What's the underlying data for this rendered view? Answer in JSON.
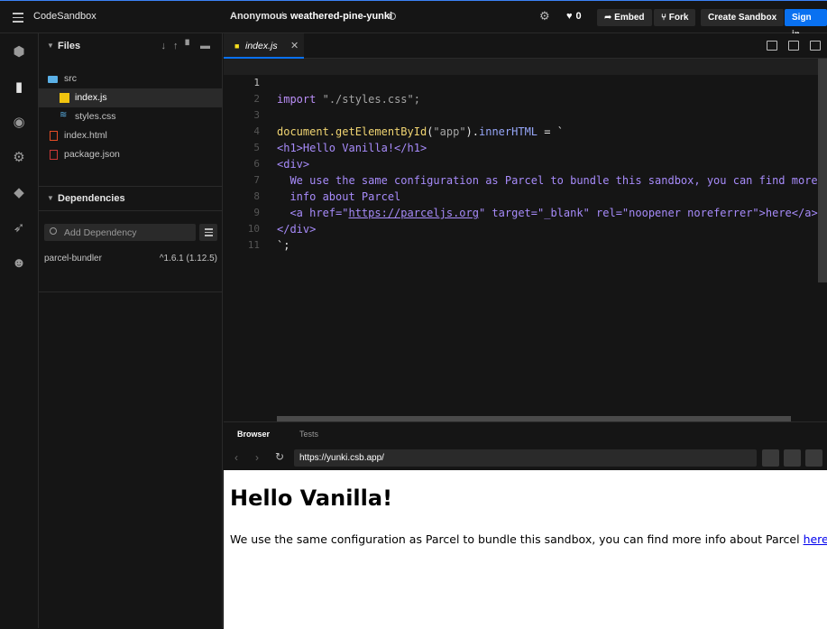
{
  "topbar": {
    "brand": "CodeSandbox",
    "owner": "Anonymous",
    "separator": "/",
    "sandbox_name": "weathered-pine-yunki",
    "likes": "0",
    "embed_label": "Embed",
    "fork_label": "Fork",
    "create_label": "Create Sandbox",
    "signin_label": "Sign in",
    "accent": "#0971f1"
  },
  "sidebar": {
    "files_title": "Files",
    "files": [
      {
        "name": "src",
        "icon": "folder-icon"
      },
      {
        "name": "index.js",
        "icon": "js-file-icon"
      },
      {
        "name": "styles.css",
        "icon": "css-file-icon"
      },
      {
        "name": "index.html",
        "icon": "html-file-icon"
      },
      {
        "name": "package.json",
        "icon": "npm-file-icon"
      }
    ],
    "dependencies_title": "Dependencies",
    "add_dependency_placeholder": "Add Dependency",
    "dependencies": [
      {
        "name": "parcel-bundler",
        "version": "^1.6.1 (1.12.5)"
      }
    ]
  },
  "editor": {
    "tab_name": "index.js",
    "line_numbers": [
      "1",
      "2",
      "3",
      "4",
      "5",
      "6",
      "7",
      "8",
      "9",
      "10",
      "11"
    ],
    "code": {
      "l1_kw": "import",
      "l1_str": "\"./styles.css\";",
      "l3_a": "document.",
      "l3_fn": "getElementById",
      "l3_b": "(",
      "l3_str": "\"app\"",
      "l3_c": ").",
      "l3_prop": "innerHTML",
      "l3_d": " = `",
      "l4": "<h1>Hello Vanilla!</h1>",
      "l5": "<div>",
      "l6": "  We use the same configuration as Parcel to bundle this sandbox, you can find more",
      "l7": "  info about Parcel",
      "l8_a": "  <a href=\"",
      "l8_link": "https://parceljs.org",
      "l8_b": "\" target=\"_blank\" rel=\"noopener noreferrer\">here</a>.",
      "l9": "</div>",
      "l10": "`;"
    }
  },
  "preview": {
    "tab_browser": "Browser",
    "tab_tests": "Tests",
    "url": "https://yunki.csb.app/",
    "page_heading": "Hello Vanilla!",
    "page_text": "We use the same configuration as Parcel to bundle this sandbox, you can find more info about Parcel ",
    "page_link": "here",
    "page_after": "."
  }
}
